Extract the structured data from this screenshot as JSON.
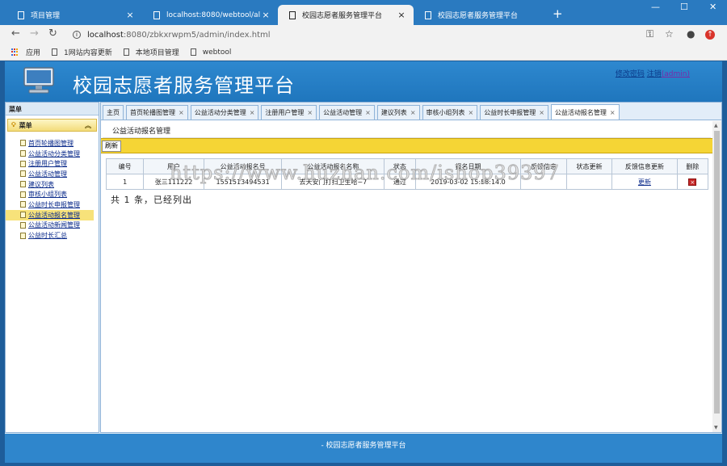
{
  "browser": {
    "tabs": [
      {
        "title": "项目管理",
        "active": false
      },
      {
        "title": "localhost:8080/webtool/all/in",
        "active": false
      },
      {
        "title": "校园志愿者服务管理平台",
        "active": true
      },
      {
        "title": "校园志愿者服务管理平台",
        "active": false
      }
    ],
    "new_tab": "+",
    "url_host": "localhost",
    "url_rest": ":8080/zbkxrwpm5/admin/index.html",
    "bookmarks": [
      "应用",
      "1网站内容更新",
      "本地项目管理",
      "webtool"
    ]
  },
  "header": {
    "title": "校园志愿者服务管理平台",
    "change_password": "修改密码",
    "logout": "注销",
    "user": "(admin)"
  },
  "sidebar": {
    "heading": "菜单",
    "menu_label": "菜单",
    "items": [
      {
        "label": "首页轮播图管理",
        "active": false
      },
      {
        "label": "公益活动分类管理",
        "active": false
      },
      {
        "label": "注册用户管理",
        "active": false
      },
      {
        "label": "公益活动管理",
        "active": false
      },
      {
        "label": "建议列表",
        "active": false
      },
      {
        "label": "审核小组列表",
        "active": false
      },
      {
        "label": "公益时长申报管理",
        "active": false
      },
      {
        "label": "公益活动报名管理",
        "active": true
      },
      {
        "label": "公益活动新闻管理",
        "active": false
      },
      {
        "label": "公益时长汇总",
        "active": false
      }
    ]
  },
  "tabs": [
    {
      "label": "主页",
      "closable": false
    },
    {
      "label": "首页轮播图管理",
      "closable": true
    },
    {
      "label": "公益活动分类管理",
      "closable": true
    },
    {
      "label": "注册用户管理",
      "closable": true
    },
    {
      "label": "公益活动管理",
      "closable": true
    },
    {
      "label": "建议列表",
      "closable": true
    },
    {
      "label": "审核小组列表",
      "closable": true
    },
    {
      "label": "公益时长申报管理",
      "closable": true
    },
    {
      "label": "公益活动报名管理",
      "closable": true,
      "active": true
    }
  ],
  "panel": {
    "title": "公益活动报名管理",
    "refresh_label": "刷新"
  },
  "table": {
    "columns": [
      "编号",
      "用户",
      "公益活动报名号",
      "公益活动报名名称",
      "状态",
      "报名日期",
      "反馈信息",
      "状态更新",
      "反馈信息更新",
      "删除"
    ],
    "rows": [
      {
        "id": "1",
        "user": "张三111222",
        "signup_no": "1551513494531",
        "name": "去天安门打扫卫生哈~7",
        "status": "通过",
        "date": "2019-03-02 15:58:14.0",
        "feedback": "",
        "status_update": "",
        "feedback_update": "更新",
        "delete": "×"
      }
    ]
  },
  "summary": "共 1 条，已经列出",
  "watermark": "https://www.huzhan.com/ishop39397",
  "footer": "- 校园志愿者服务管理平台",
  "colors": {
    "header_blue": "#2e88cf",
    "toolbar_yellow": "#f5d535",
    "browser_blue": "#2a7ac0"
  }
}
